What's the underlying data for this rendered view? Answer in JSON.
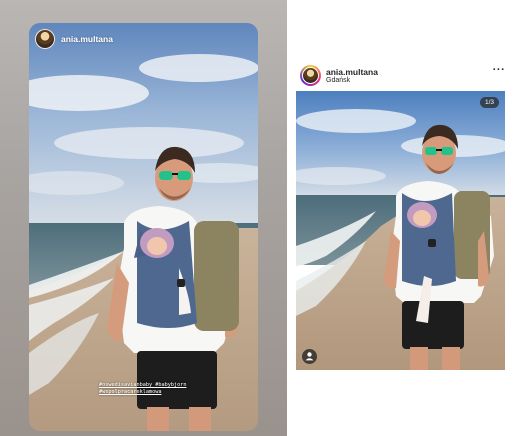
{
  "story": {
    "username": "ania.multana",
    "hashtags": [
      "#oswedisavianbaby #babybjorn",
      "#wspolpracareklamowa"
    ]
  },
  "post": {
    "username": "ania.multana",
    "location": "Gdańsk",
    "page_counter": "1/3"
  },
  "icons": {
    "more": "more-options-icon",
    "tagged_people": "person-icon"
  }
}
